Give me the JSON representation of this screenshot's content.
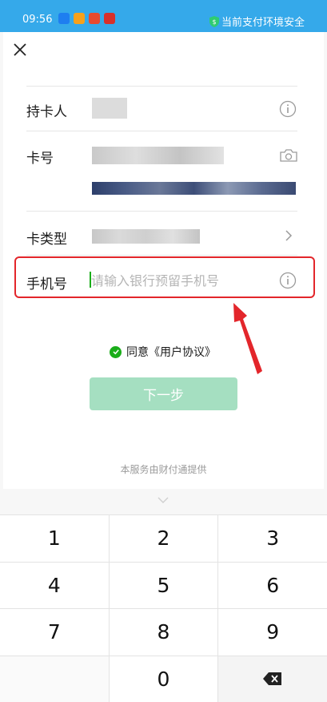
{
  "status_bar": {
    "time": "09:56",
    "security_text": "当前支付环境安全",
    "app_icon_colors": [
      "#1e7ef0",
      "#f7a11a",
      "#e84a2f",
      "#d7302b"
    ]
  },
  "form": {
    "cardholder_label": "持卡人",
    "card_number_label": "卡号",
    "card_type_label": "卡类型",
    "phone_label": "手机号",
    "phone_placeholder": "请输入银行预留手机号",
    "phone_value": ""
  },
  "agreement": {
    "agree_text": "同意",
    "link_text": "《用户协议》",
    "checked": true
  },
  "next_button_label": "下一步",
  "provider_text": "本服务由财付通提供",
  "keypad": {
    "keys": [
      "1",
      "2",
      "3",
      "4",
      "5",
      "6",
      "7",
      "8",
      "9",
      "",
      "0",
      "⌫"
    ]
  },
  "colors": {
    "status_bar": "#35a9ea",
    "accent_green": "#1aad19",
    "button_disabled": "#a5dfc1",
    "annotation_red": "#e3262b"
  }
}
